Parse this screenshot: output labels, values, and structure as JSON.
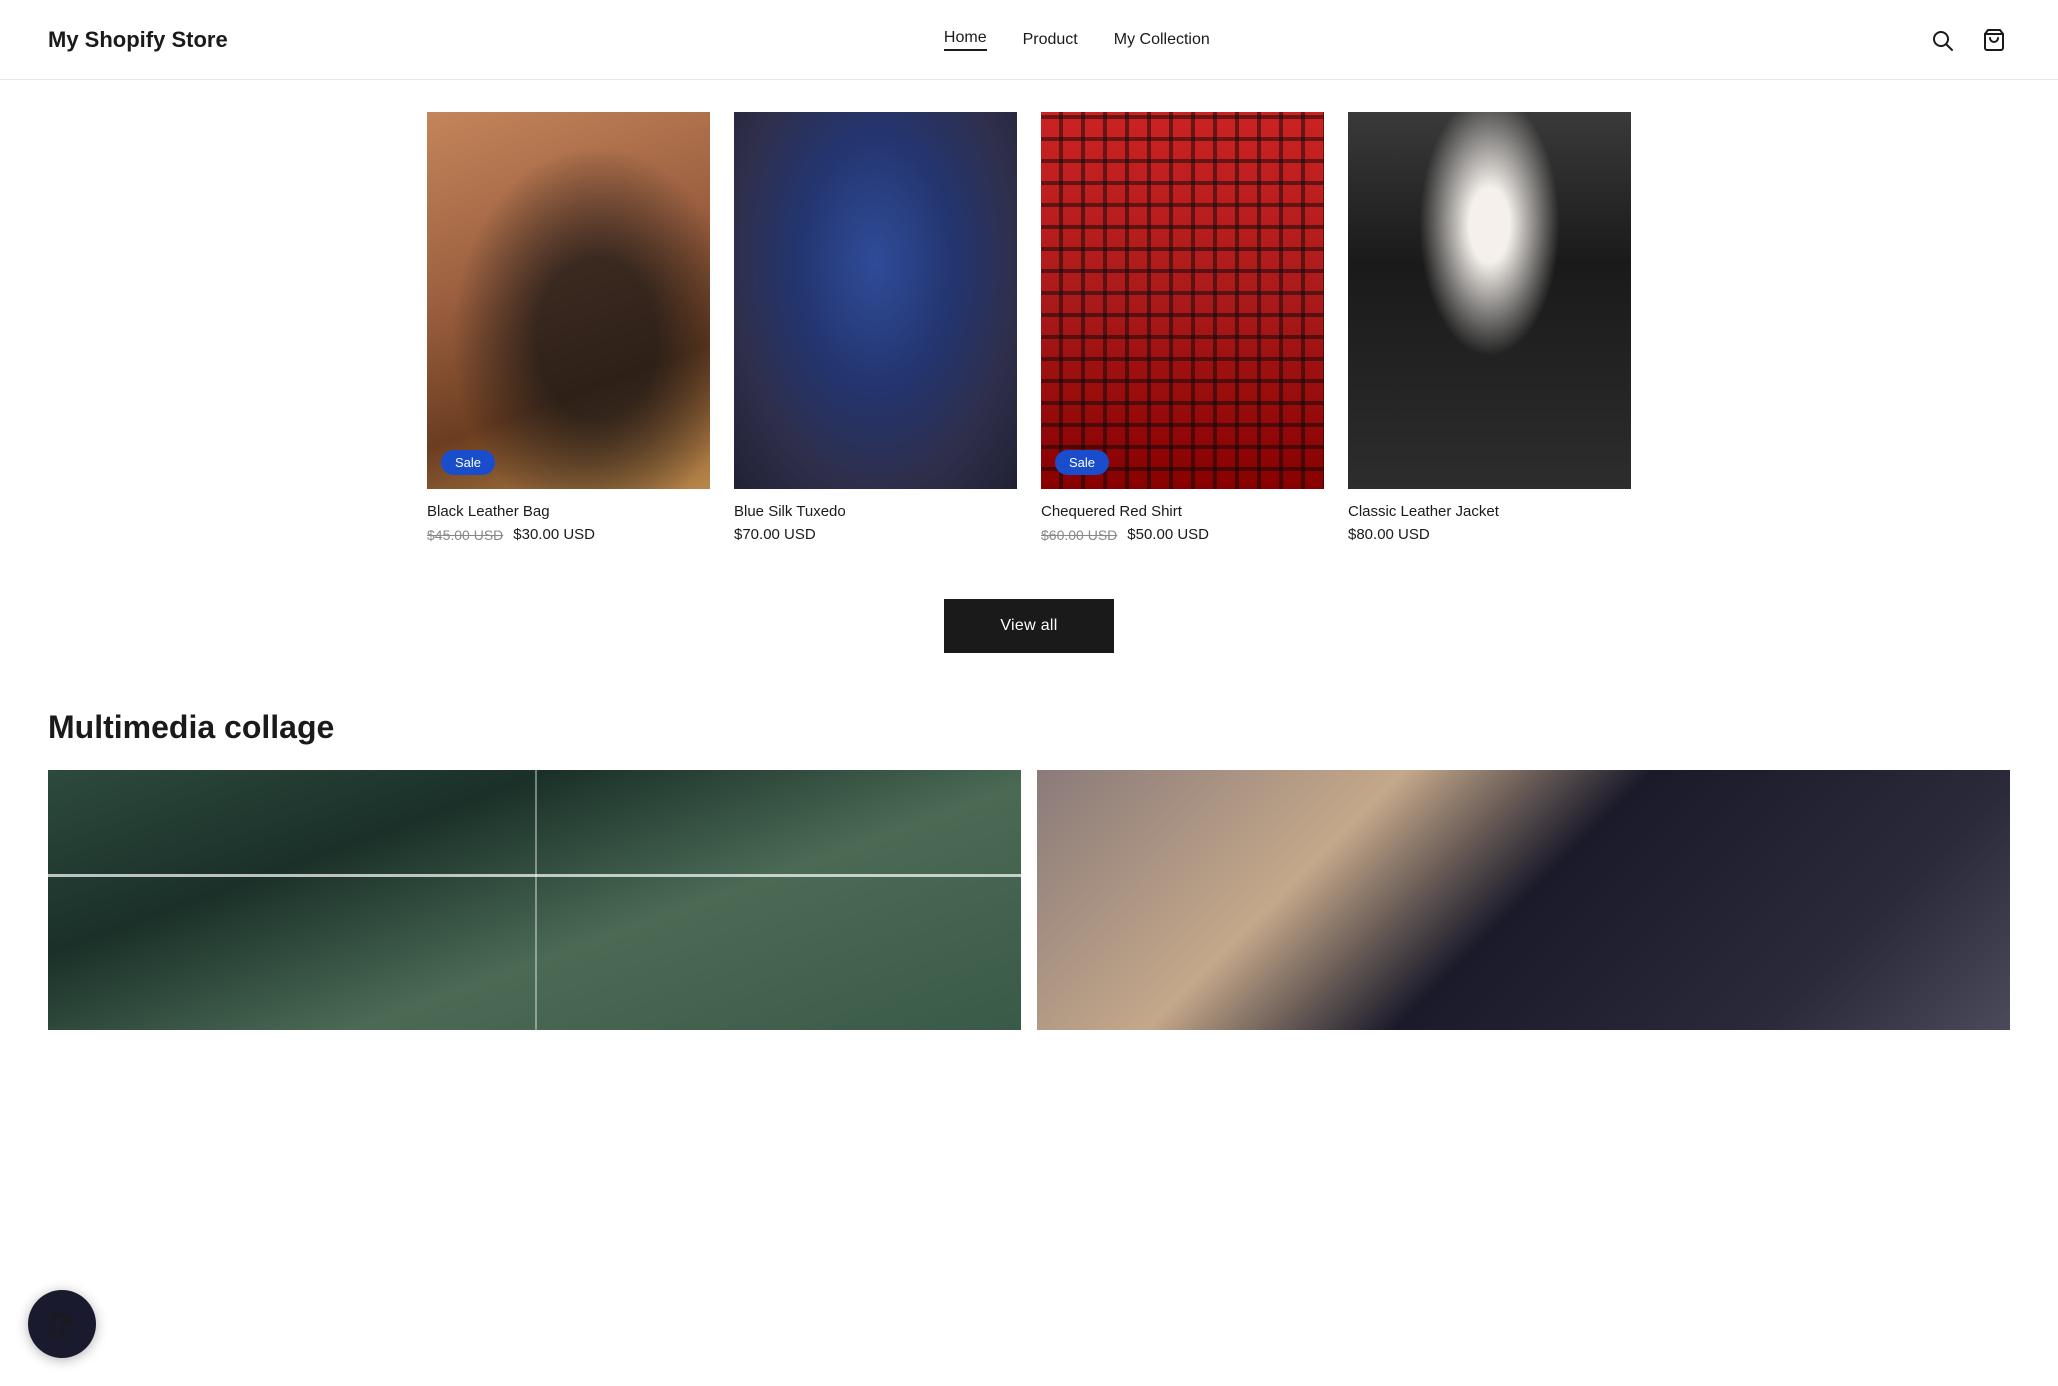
{
  "store": {
    "name": "My Shopify Store"
  },
  "nav": {
    "links": [
      {
        "label": "Home",
        "active": true
      },
      {
        "label": "Product",
        "active": false
      },
      {
        "label": "My Collection",
        "active": false
      }
    ]
  },
  "products": [
    {
      "name": "Black Leather Bag",
      "sale": true,
      "price_original": "$45.00 USD",
      "price_sale": "$30.00 USD",
      "price_regular": null,
      "img_class": "img-bag"
    },
    {
      "name": "Blue Silk Tuxedo",
      "sale": false,
      "price_original": null,
      "price_sale": null,
      "price_regular": "$70.00 USD",
      "img_class": "img-tuxedo"
    },
    {
      "name": "Chequered Red Shirt",
      "sale": true,
      "price_original": "$60.00 USD",
      "price_sale": "$50.00 USD",
      "price_regular": null,
      "img_class": "img-shirt"
    },
    {
      "name": "Classic Leather Jacket",
      "sale": false,
      "price_original": null,
      "price_sale": null,
      "price_regular": "$80.00 USD",
      "img_class": "img-jacket"
    }
  ],
  "view_all_label": "View all",
  "collage": {
    "title": "Multimedia collage"
  },
  "badge": {
    "icon": "🛍"
  },
  "sale_label": "Sale"
}
